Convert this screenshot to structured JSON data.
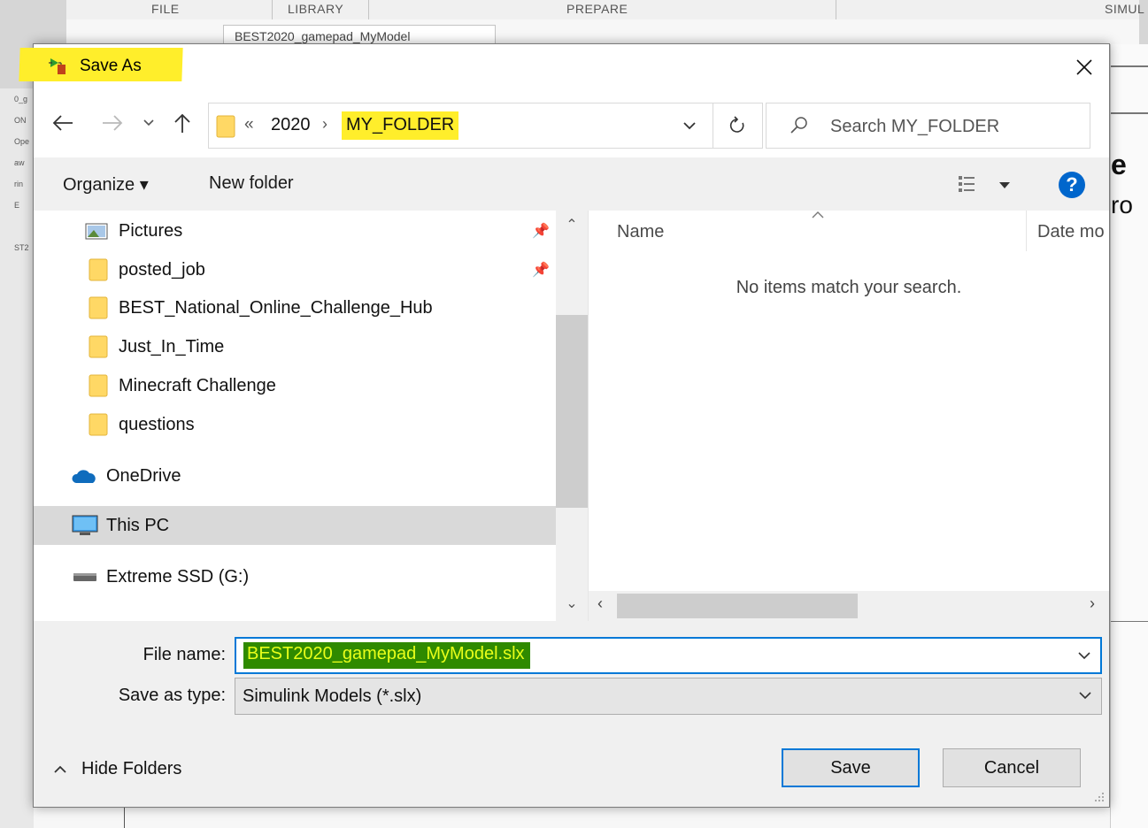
{
  "background": {
    "ribbon_tabs": [
      "FILE",
      "LIBRARY",
      "PREPARE",
      "SIMUL"
    ],
    "tab_title": "BEST2020_gamepad_MyModel",
    "left_fragments": [
      "0_g",
      "ON",
      "Ope",
      "aw",
      "rin",
      "E",
      "",
      "ST2"
    ],
    "right_text1": "e",
    "right_text2": "ro"
  },
  "dialog": {
    "title": "Save As",
    "address": {
      "overflow_marker": "«",
      "crumbs": [
        "2020",
        "MY_FOLDER"
      ],
      "separator": "›"
    },
    "search": {
      "placeholder": "Search MY_FOLDER"
    },
    "toolbar": {
      "organize": "Organize ▾",
      "new_folder": "New folder"
    },
    "nav_items": [
      {
        "label": "Pictures",
        "icon": "pictures-icon",
        "pinned": true
      },
      {
        "label": "posted_job",
        "icon": "folder-icon",
        "pinned": true
      },
      {
        "label": "BEST_National_Online_Challenge_Hub",
        "icon": "folder-icon"
      },
      {
        "label": "Just_In_Time",
        "icon": "folder-icon"
      },
      {
        "label": "Minecraft Challenge",
        "icon": "folder-icon"
      },
      {
        "label": "questions",
        "icon": "folder-icon"
      },
      {
        "label": "OneDrive",
        "icon": "onedrive-icon"
      },
      {
        "label": "This PC",
        "icon": "this-pc-icon",
        "selected": true
      },
      {
        "label": "Extreme SSD (G:)",
        "icon": "drive-icon"
      }
    ],
    "file_list": {
      "columns": [
        "Name",
        "Date mo"
      ],
      "empty_message": "No items match your search."
    },
    "form": {
      "file_name_label": "File name:",
      "file_name_value": "BEST2020_gamepad_MyModel.slx",
      "save_type_label": "Save as type:",
      "save_type_value": "Simulink Models (*.slx)"
    },
    "hide_folders": "Hide Folders",
    "save_button": "Save",
    "cancel_button": "Cancel",
    "colors": {
      "accent": "#0078d7",
      "highlight": "#ffee2b",
      "help": "#0066cc"
    }
  }
}
